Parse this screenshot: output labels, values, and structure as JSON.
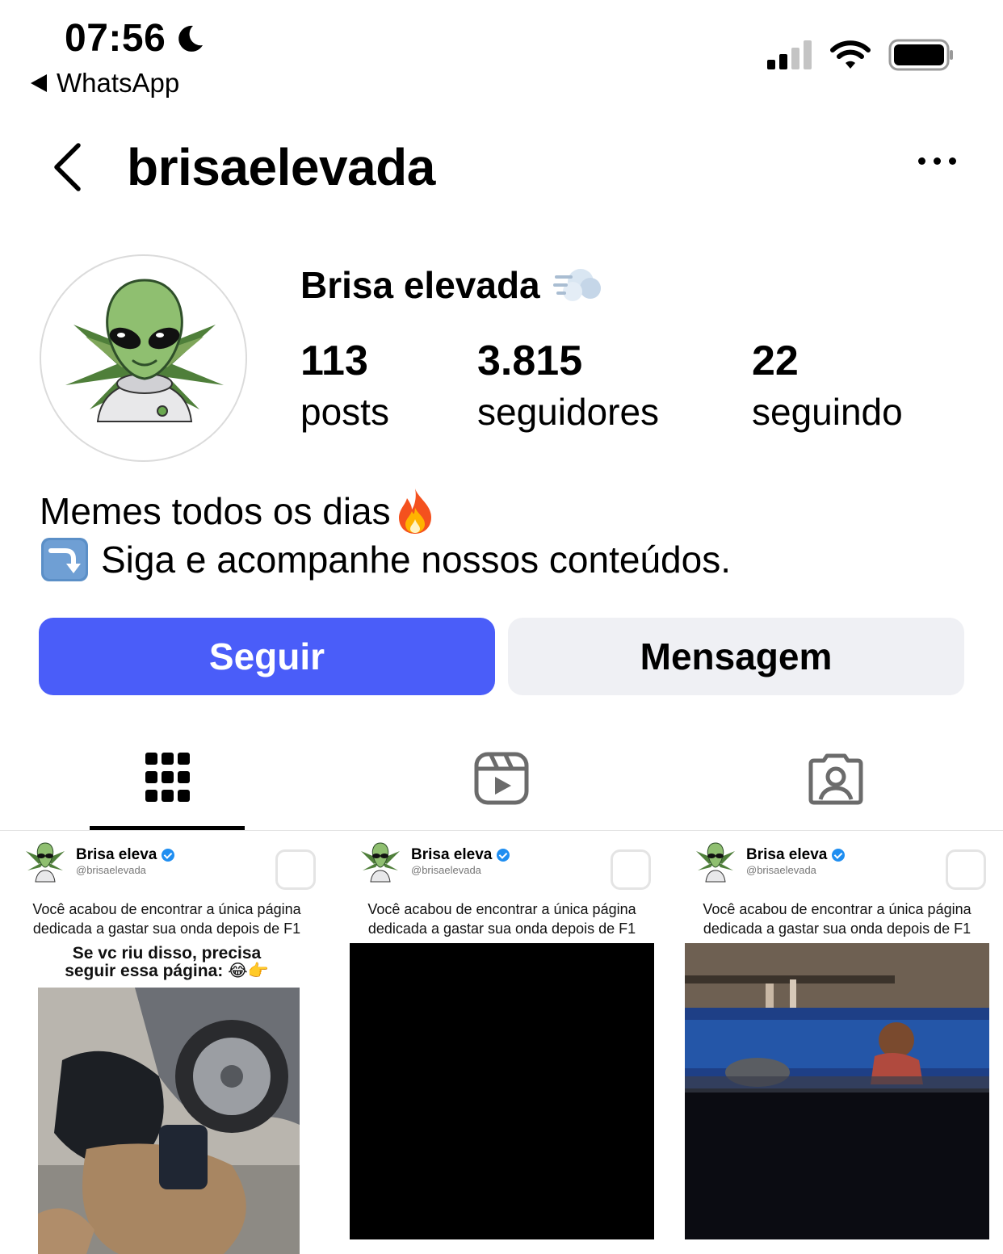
{
  "status_bar": {
    "time": "07:56",
    "back_app": "WhatsApp"
  },
  "header": {
    "username": "brisaelevada"
  },
  "profile": {
    "display_name": "Brisa elevada",
    "stats": [
      {
        "value": "113",
        "label": "posts"
      },
      {
        "value": "3.815",
        "label": "seguidores"
      },
      {
        "value": "22",
        "label": "seguindo"
      }
    ],
    "bio_line1": "Memes todos os dias",
    "bio_line2": "Siga e acompanhe nossos conteúdos."
  },
  "actions": {
    "follow_label": "Seguir",
    "message_label": "Mensagem"
  },
  "tabs": [
    {
      "icon": "grid-icon",
      "active": true
    },
    {
      "icon": "reels-icon",
      "active": false
    },
    {
      "icon": "tagged-icon",
      "active": false
    }
  ],
  "posts": [
    {
      "name": "Brisa eleva",
      "handle": "@brisaelevada",
      "caption_line1": "Você acabou de encontrar a única página",
      "caption_line2": "dedicada a gastar sua onda depois de F1",
      "sub_line1": "Se vc riu disso, precisa",
      "sub_line2": "seguir essa página:"
    },
    {
      "name": "Brisa eleva",
      "handle": "@brisaelevada",
      "caption_line1": "Você acabou de encontrar a única página",
      "caption_line2": "dedicada a gastar sua onda depois de F1"
    },
    {
      "name": "Brisa eleva",
      "handle": "@brisaelevada",
      "caption_line1": "Você acabou de encontrar a única página",
      "caption_line2": "dedicada a gastar sua onda depois de F1"
    }
  ],
  "colors": {
    "follow_button": "#4a5df9",
    "message_button": "#eff0f4",
    "verified": "#1f8ef1"
  }
}
